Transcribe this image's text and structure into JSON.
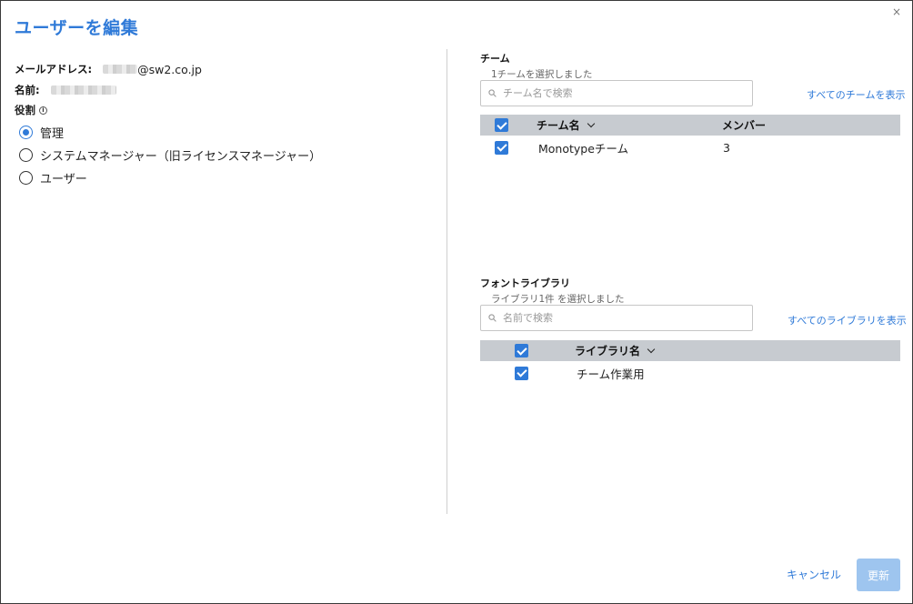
{
  "dialog": {
    "title": "ユーザーを編集",
    "close_label": "×"
  },
  "user": {
    "email_label": "メールアドレス:",
    "email_domain": "@sw2.co.jp",
    "name_label": "名前:",
    "role_label": "役割",
    "info_glyph": "i",
    "roles": [
      {
        "label": "管理",
        "selected": true
      },
      {
        "label": "システムマネージャー（旧ライセンスマネージャー）",
        "selected": false
      },
      {
        "label": "ユーザー",
        "selected": false
      }
    ]
  },
  "teams": {
    "title": "チーム",
    "selected_count_text": "1チームを選択しました",
    "search_placeholder": "チーム名で検索",
    "show_all_label": "すべてのチームを表示",
    "columns": {
      "name": "チーム名",
      "members": "メンバー"
    },
    "rows": [
      {
        "checked": true,
        "name": "Monotypeチーム",
        "members": "3"
      }
    ]
  },
  "libraries": {
    "title": "フォントライブラリ",
    "selected_count_text": "ライブラリ1件 を選択しました",
    "search_placeholder": "名前で検索",
    "show_all_label": "すべてのライブラリを表示",
    "columns": {
      "name": "ライブラリ名"
    },
    "rows": [
      {
        "checked": true,
        "name": "チーム作業用"
      }
    ]
  },
  "footer": {
    "cancel_label": "キャンセル",
    "update_label": "更新"
  },
  "colors": {
    "accent": "#2f7ad8",
    "table_header": "#c7cbd0",
    "update_disabled": "#9ec5ef"
  }
}
